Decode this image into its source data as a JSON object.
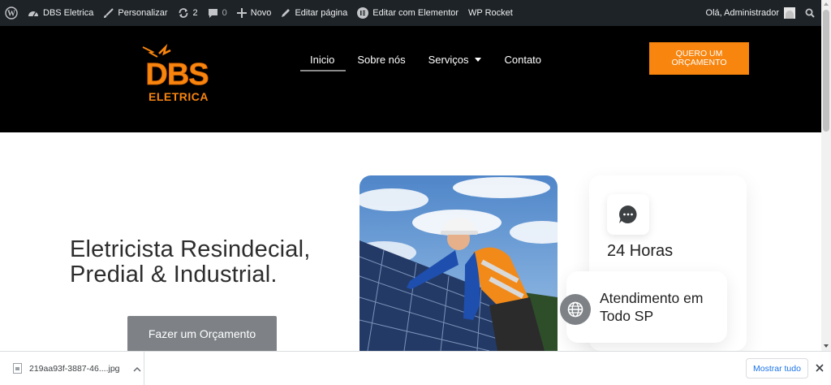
{
  "adminbar": {
    "site_name": "DBS Eletrica",
    "customize": "Personalizar",
    "updates_count": "2",
    "comments_count": "0",
    "new": "Novo",
    "edit_page": "Editar página",
    "edit_elementor": "Editar com Elementor",
    "wp_rocket": "WP Rocket",
    "greeting": "Olá, Administrador"
  },
  "header": {
    "logo_line1": "DBS",
    "logo_line2": "ELETRICA",
    "nav": [
      "Inicio",
      "Sobre nós",
      "Serviços",
      "Contato"
    ],
    "active_nav": "Inicio",
    "cta_label": "QUERO UM ORÇAMENTO"
  },
  "hero": {
    "title_line1": "Eletricista Resindecial,",
    "title_line2": "Predial & Industrial.",
    "button_label": "Fazer um Orçamento",
    "card_hours": "24 Horas",
    "card_service": "Atendimento em Todo SP"
  },
  "downloads": {
    "file_name": "219aa93f-3887-46....jpg",
    "show_all": "Mostrar tudo"
  },
  "colors": {
    "adminbar_bg": "#1d2327",
    "header_bg": "#000000",
    "accent_orange": "#f7850e",
    "button_gray": "#7e8287",
    "link_blue": "#1a73e8"
  }
}
